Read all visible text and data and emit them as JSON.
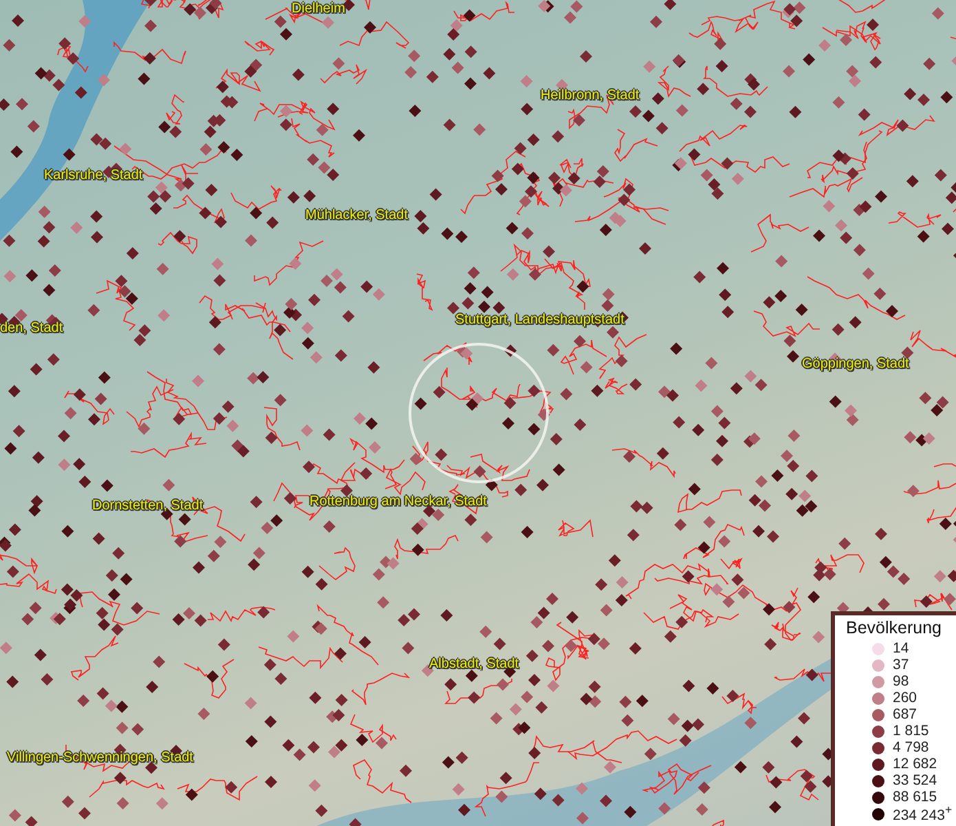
{
  "map": {
    "places": [
      {
        "name": "Dielheim"
      },
      {
        "name": "Heilbronn, Stadt"
      },
      {
        "name": "Karlsruhe, Stadt"
      },
      {
        "name": "Mühlacker, Stadt"
      },
      {
        "name": "den, Stadt"
      },
      {
        "name": "Stuttgart, Landeshauptstadt"
      },
      {
        "name": "Göppingen, Stadt"
      },
      {
        "name": "Dornstetten, Stadt"
      },
      {
        "name": "Rottenburg am Neckar, Stadt"
      },
      {
        "name": "Albstadt, Stadt"
      },
      {
        "name": "Villingen-Schwenningen, Stadt"
      }
    ]
  },
  "legend": {
    "title": "Bevölkerung",
    "items": [
      {
        "label": "14",
        "color": "#f4dce8"
      },
      {
        "label": "37",
        "color": "#e3b8c4"
      },
      {
        "label": "98",
        "color": "#d09aa5"
      },
      {
        "label": "260",
        "color": "#c07f88"
      },
      {
        "label": "687",
        "color": "#a85a63"
      },
      {
        "label": "1 815",
        "color": "#8e3c45"
      },
      {
        "label": "4 798",
        "color": "#7a2a33"
      },
      {
        "label": "12 682",
        "color": "#5e1a20"
      },
      {
        "label": "33 524",
        "color": "#4a1014"
      },
      {
        "label": "88 615",
        "color": "#360a0c"
      },
      {
        "label": "234 243$^{+}$",
        "color": "#220406"
      }
    ]
  }
}
